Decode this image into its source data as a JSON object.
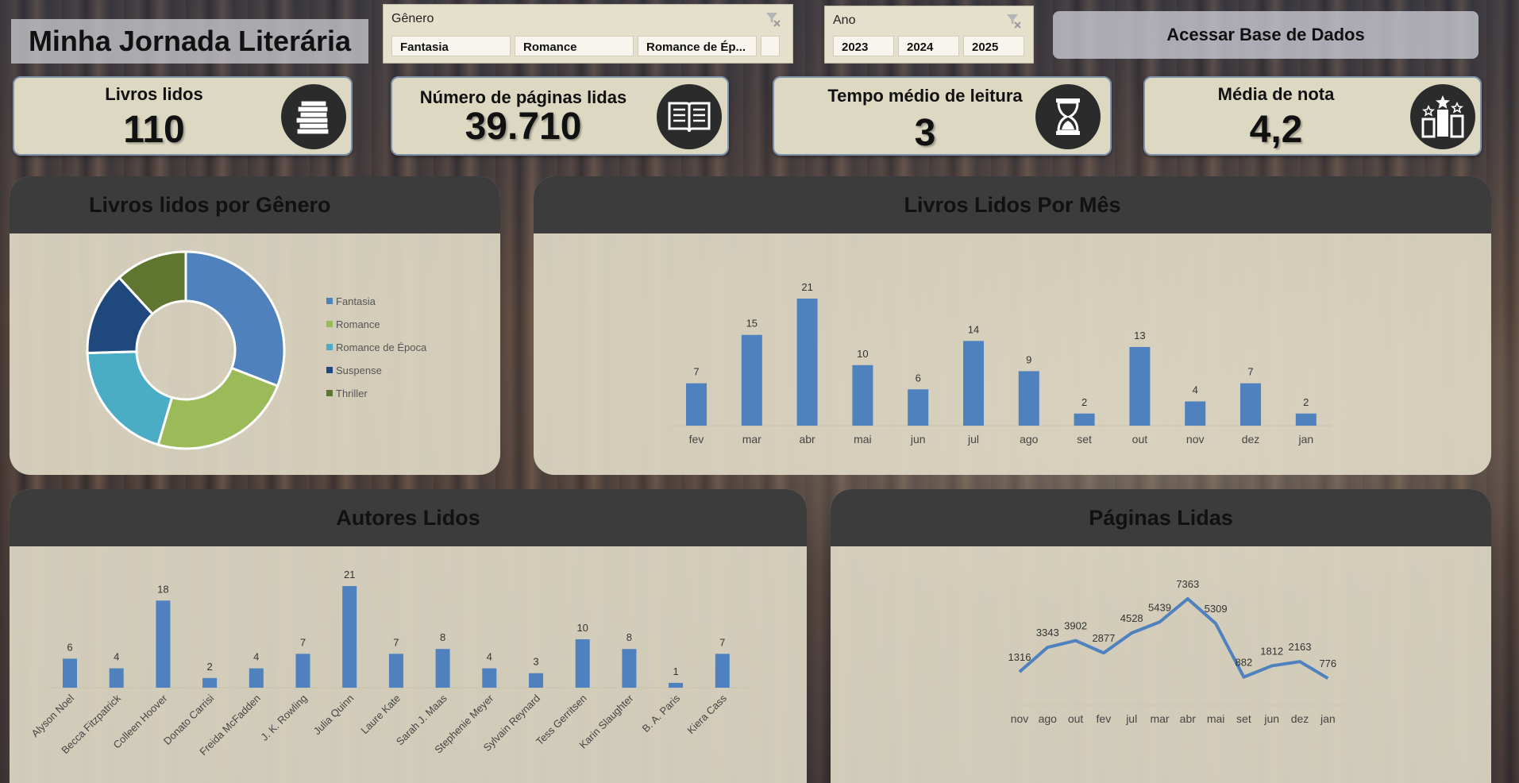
{
  "header": {
    "title": "Minha Jornada Literária",
    "access_button": "Acessar Base de Dados"
  },
  "slicers": {
    "genre": {
      "title": "Gênero",
      "items": [
        "Fantasia",
        "Romance",
        "Romance de Ép...",
        ""
      ]
    },
    "year": {
      "title": "Ano",
      "items": [
        "2023",
        "2024",
        "2025"
      ]
    }
  },
  "kpis": {
    "books": {
      "label": "Livros lidos",
      "value": "110",
      "icon": "books-stack-icon"
    },
    "pages": {
      "label": "Número de páginas lidas",
      "value": "39.710",
      "icon": "open-book-icon"
    },
    "time": {
      "label": "Tempo médio de leitura",
      "value": "3",
      "icon": "hourglass-icon"
    },
    "rating": {
      "label": "Média de nota",
      "value": "4,2",
      "icon": "podium-stars-icon"
    }
  },
  "colors": {
    "bar": "#4e81bd",
    "donut": [
      "#4f81bd",
      "#9bbb59",
      "#4bacc6",
      "#1f497d",
      "#5f7530"
    ]
  },
  "chart_data": [
    {
      "type": "pie",
      "title": "Livros lidos por Gênero",
      "categories": [
        "Fantasia",
        "Romance",
        "Romance de Época",
        "Suspense",
        "Thriller"
      ],
      "values": [
        34,
        26,
        22,
        15,
        13
      ],
      "legend": "right"
    },
    {
      "type": "bar",
      "title": "Livros Lidos Por Mês",
      "categories": [
        "fev",
        "mar",
        "abr",
        "mai",
        "jun",
        "jul",
        "ago",
        "set",
        "out",
        "nov",
        "dez",
        "jan"
      ],
      "values": [
        7,
        15,
        21,
        10,
        6,
        14,
        9,
        2,
        13,
        4,
        7,
        2
      ],
      "ylim": [
        0,
        21
      ]
    },
    {
      "type": "bar",
      "title": "Autores Lidos",
      "categories": [
        "Alyson Noel",
        "Becca Fitzpatrick",
        "Colleen Hoover",
        "Donato Carrisi",
        "Freida McFadden",
        "J. K. Rowling",
        "Julia Quinn",
        "Laure Kate",
        "Sarah J. Maas",
        "Stephenie Meyer",
        "Sylvain Reynard",
        "Tess Gerritsen",
        "Karin Slaughter",
        "B. A. Paris",
        "Kiera Cass"
      ],
      "values": [
        6,
        4,
        18,
        2,
        4,
        7,
        21,
        7,
        8,
        4,
        3,
        10,
        8,
        1,
        7
      ],
      "ylim": [
        0,
        21
      ]
    },
    {
      "type": "line",
      "title": "Páginas Lidas",
      "categories": [
        "nov",
        "ago",
        "out",
        "fev",
        "jul",
        "mar",
        "abr",
        "mai",
        "set",
        "jun",
        "dez",
        "jan"
      ],
      "values": [
        1316,
        3343,
        3902,
        2877,
        4528,
        5439,
        7363,
        5309,
        882,
        1812,
        2163,
        776
      ],
      "ylim": [
        0,
        7363
      ]
    }
  ]
}
